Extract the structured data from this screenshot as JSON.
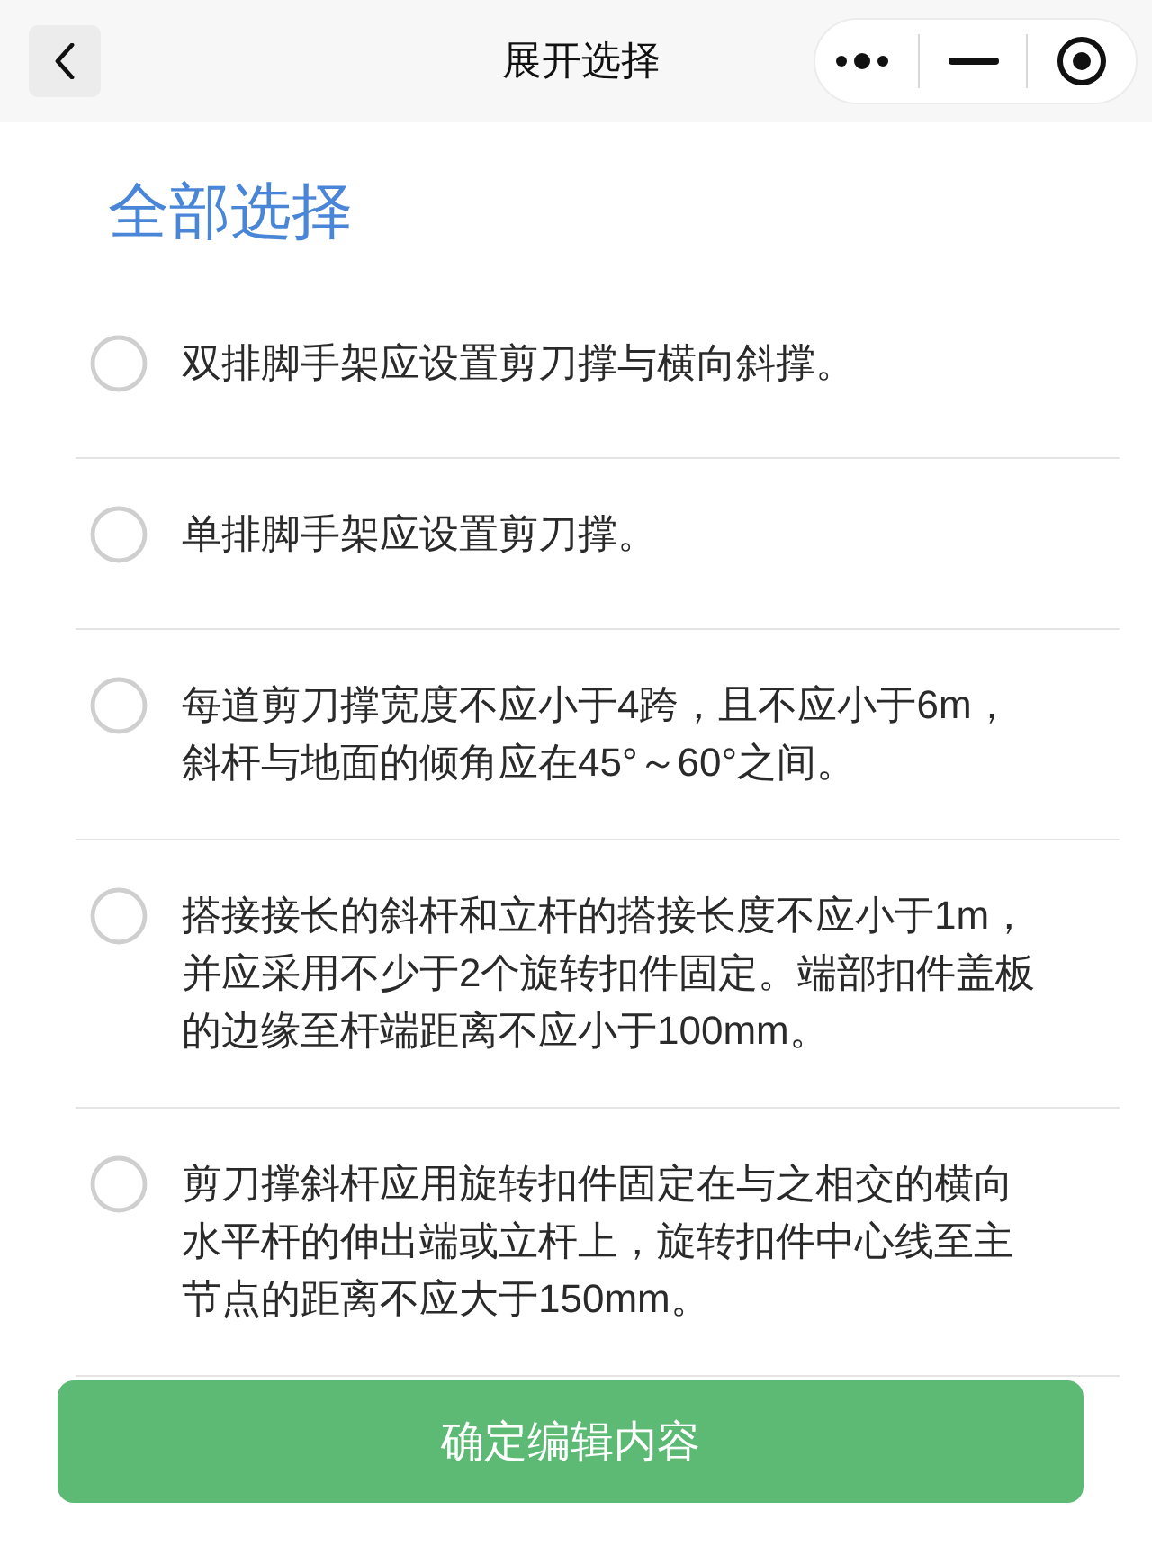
{
  "header": {
    "title": "展开选择"
  },
  "select_all": {
    "label": "全部选择"
  },
  "options": [
    {
      "text": "双排脚手架应设置剪刀撑与横向斜撑。",
      "selected": false
    },
    {
      "text": "单排脚手架应设置剪刀撑。",
      "selected": false
    },
    {
      "text": "每道剪刀撑宽度不应小于4跨，且不应小于6m，斜杆与地面的倾角应在45°～60°之间。",
      "selected": false
    },
    {
      "text": "搭接接长的斜杆和立杆的搭接长度不应小于1m，并应采用不少于2个旋转扣件固定。端部扣件盖板的边缘至杆端距离不应小于100mm。",
      "selected": false
    },
    {
      "text": "剪刀撑斜杆应用旋转扣件固定在与之相交的横向水平杆的伸出端或立杆上，旋转扣件中心线至主节点的距离不应大于150mm。",
      "selected": false
    }
  ],
  "confirm_button": {
    "label": "确定编辑内容"
  }
}
